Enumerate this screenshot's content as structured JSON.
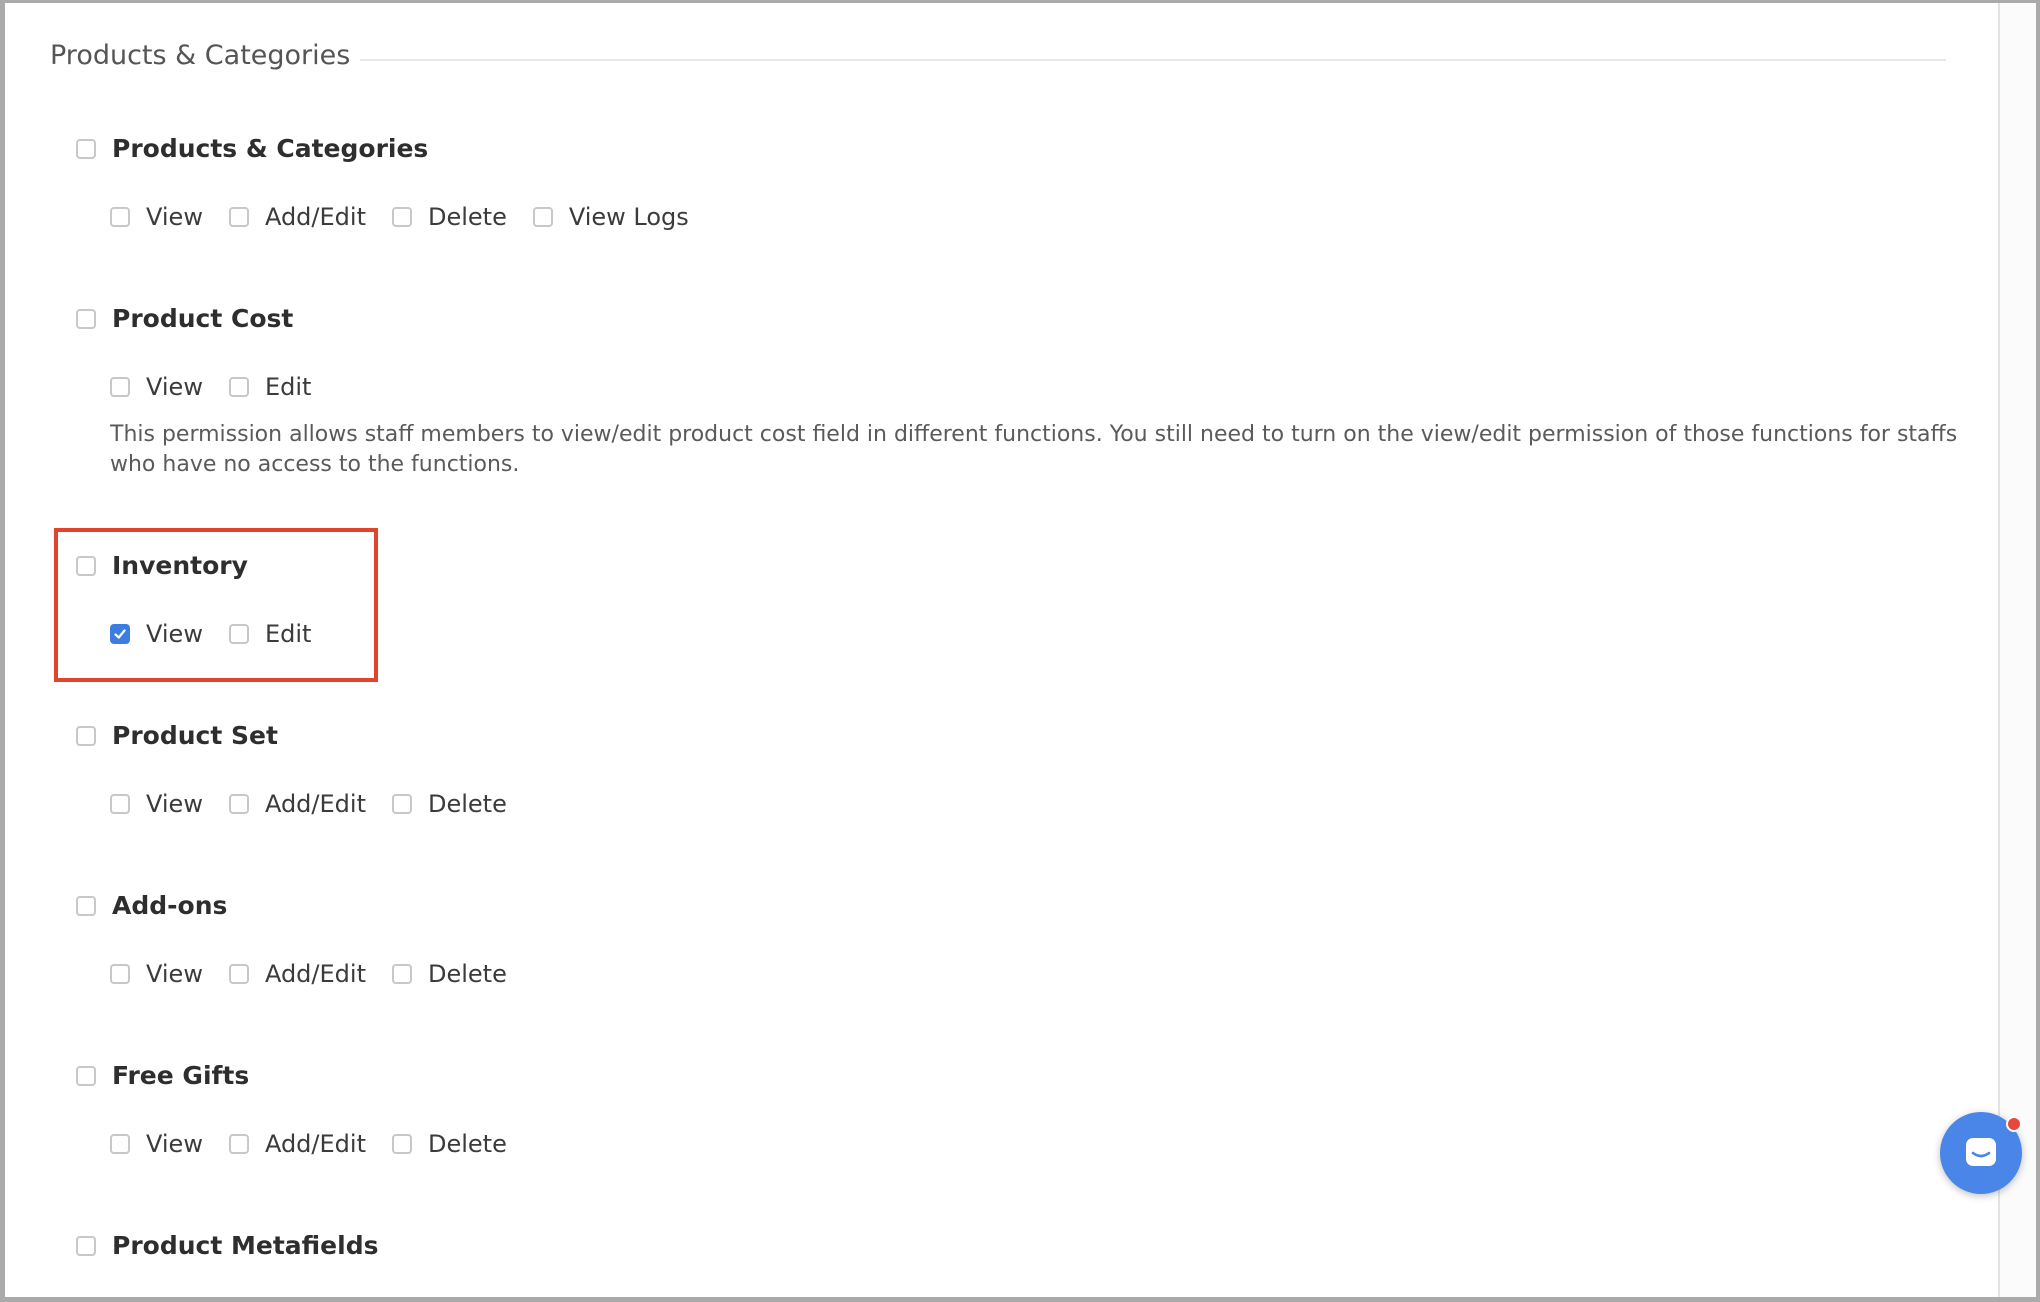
{
  "section": {
    "title": "Products & Categories"
  },
  "groups": [
    {
      "label": "Products & Categories",
      "checked": false,
      "options": [
        {
          "label": "View",
          "checked": false
        },
        {
          "label": "Add/Edit",
          "checked": false
        },
        {
          "label": "Delete",
          "checked": false
        },
        {
          "label": "View Logs",
          "checked": false
        }
      ]
    },
    {
      "label": "Product Cost",
      "checked": false,
      "options": [
        {
          "label": "View",
          "checked": false
        },
        {
          "label": "Edit",
          "checked": false
        }
      ],
      "note": "This permission allows staff members to view/edit product cost field in different functions. You still need to turn on the view/edit permission of those functions for staffs who have no access to the functions."
    },
    {
      "label": "Inventory",
      "checked": false,
      "options": [
        {
          "label": "View",
          "checked": true
        },
        {
          "label": "Edit",
          "checked": false
        }
      ]
    },
    {
      "label": "Product Set",
      "checked": false,
      "options": [
        {
          "label": "View",
          "checked": false
        },
        {
          "label": "Add/Edit",
          "checked": false
        },
        {
          "label": "Delete",
          "checked": false
        }
      ]
    },
    {
      "label": "Add-ons",
      "checked": false,
      "options": [
        {
          "label": "View",
          "checked": false
        },
        {
          "label": "Add/Edit",
          "checked": false
        },
        {
          "label": "Delete",
          "checked": false
        }
      ]
    },
    {
      "label": "Free Gifts",
      "checked": false,
      "options": [
        {
          "label": "View",
          "checked": false
        },
        {
          "label": "Add/Edit",
          "checked": false
        },
        {
          "label": "Delete",
          "checked": false
        }
      ]
    },
    {
      "label": "Product Metafields",
      "checked": false,
      "options": []
    }
  ],
  "colors": {
    "accent": "#3b7de0",
    "highlight": "#e0452b",
    "chat": "#4a86e8",
    "notification": "#e8483b"
  },
  "icons": {
    "check": "checkmark-icon",
    "chat": "chat-bubble-icon"
  }
}
